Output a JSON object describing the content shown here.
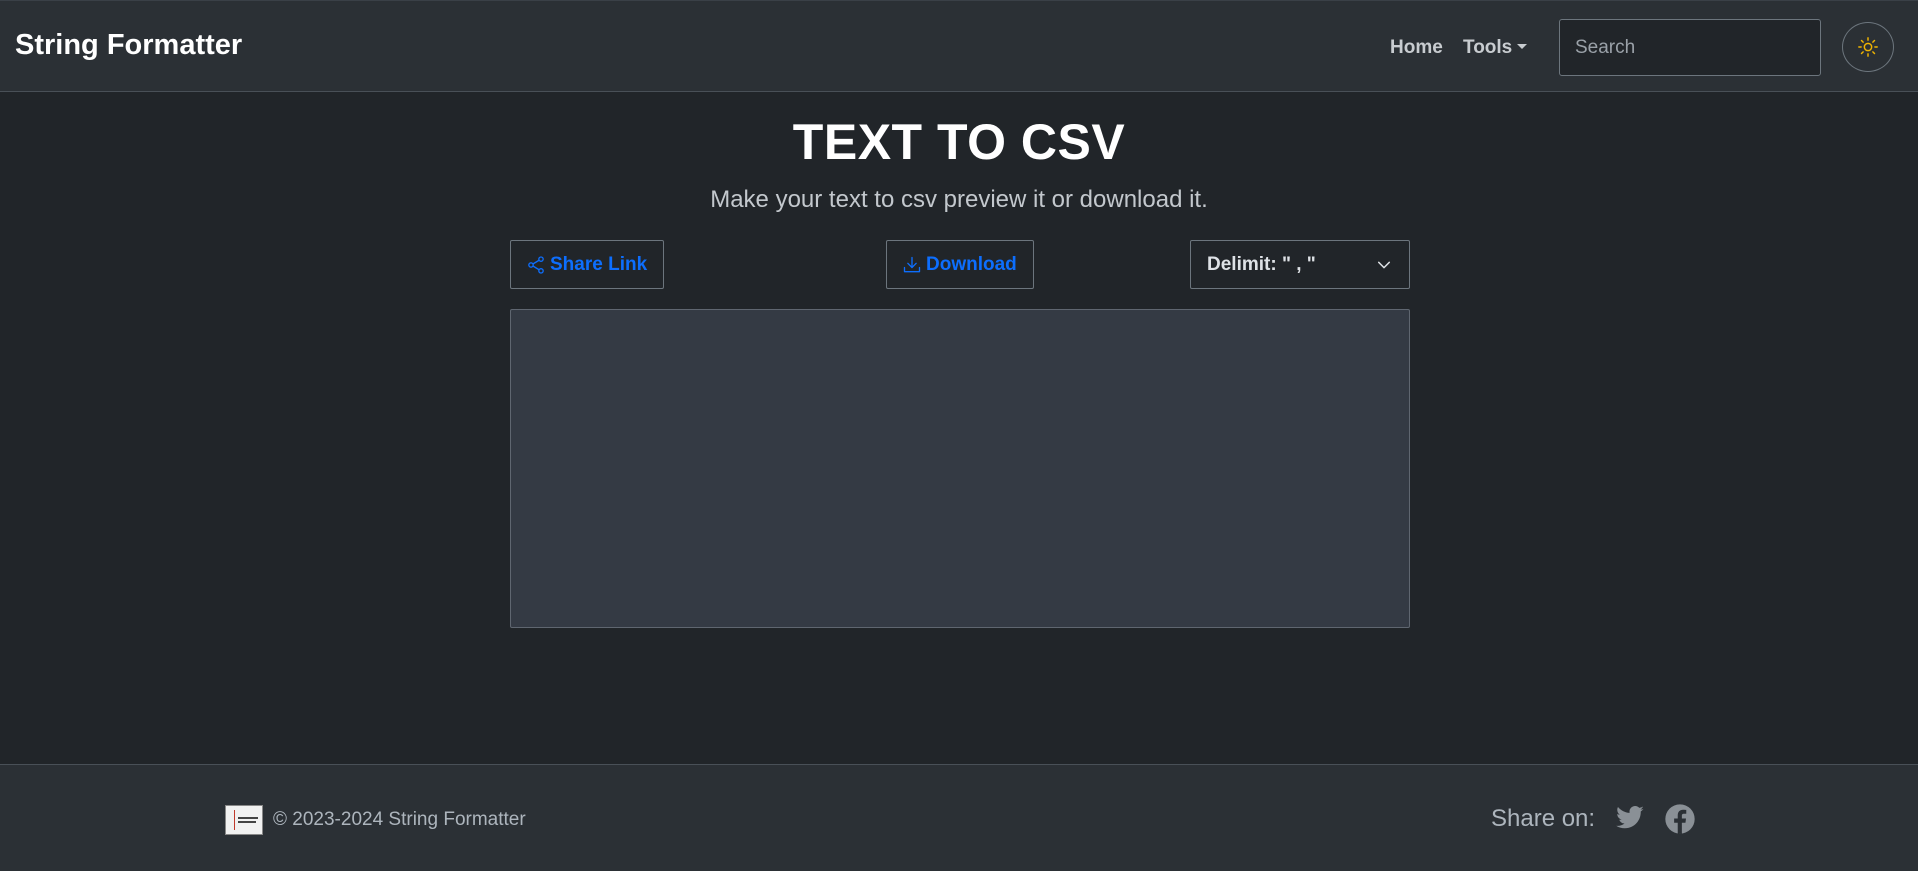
{
  "navbar": {
    "brand": "String Formatter",
    "home_label": "Home",
    "tools_label": "Tools",
    "search_placeholder": "Search",
    "theme_icon": "sun-icon"
  },
  "main": {
    "title": "TEXT TO CSV",
    "subtitle": "Make your text to csv preview it or download it.",
    "share_label": "Share Link",
    "download_label": "Download",
    "delimit_label": "Delimit: \" , \"",
    "editor_value": ""
  },
  "footer": {
    "copyright": "© 2023-2024 String Formatter",
    "share_on": "Share on:",
    "social": [
      "twitter-icon",
      "facebook-icon"
    ]
  },
  "colors": {
    "background": "#212529",
    "navbar": "#2b3035",
    "accent": "#0d6efd",
    "editor": "#343a44",
    "sun": "#f0b400"
  }
}
